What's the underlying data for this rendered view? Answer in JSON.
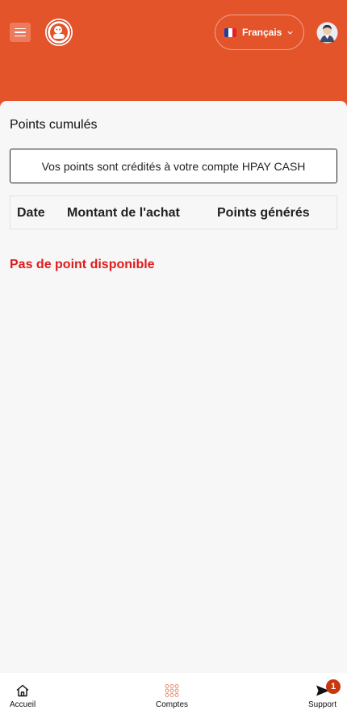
{
  "header": {
    "language": {
      "label": "Français",
      "flag_colors": [
        "#1f3fa8",
        "#ffffff",
        "#e2202c"
      ]
    }
  },
  "page": {
    "title": "Points cumulés",
    "notice": "Vos points sont crédités à votre compte HPAY CASH",
    "table": {
      "columns": [
        "Date",
        "Montant de l'achat",
        "Points générés"
      ],
      "rows": []
    },
    "empty_message": "Pas de point disponible"
  },
  "bottom_nav": {
    "items": [
      {
        "label": "Accueil",
        "icon": "home-icon"
      },
      {
        "label": "Comptes",
        "icon": "grid-icon"
      },
      {
        "label": "Support",
        "icon": "send-icon",
        "badge": "1"
      }
    ]
  },
  "colors": {
    "brand": "#e4542b",
    "empty_message": "#e11a1a",
    "badge": "#c8370f"
  }
}
